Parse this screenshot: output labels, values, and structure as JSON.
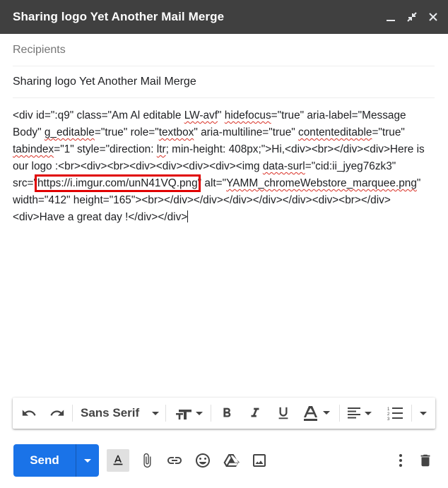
{
  "window": {
    "title": "Sharing logo Yet Another Mail Merge",
    "controls": [
      "minimize-icon",
      "exit-fullscreen-icon",
      "close-icon"
    ]
  },
  "recipients": {
    "placeholder": "Recipients"
  },
  "subject": {
    "value": "Sharing logo Yet Another Mail Merge"
  },
  "body": {
    "t1": "<div id=\":q9\" class=\"Am Al editable ",
    "s1": "LW-avf",
    "t2": "\" ",
    "s2": "hidefocus",
    "t3": "=\"true\" aria-label=\"Message Body\" ",
    "s3": "g_editable",
    "t4": "=\"true\" role=\"",
    "s4": "textbox",
    "t5": "\" aria-multiline=\"true\" ",
    "s5": "contenteditable",
    "t6": "=\"true\" ",
    "s6": "tabindex",
    "t7": "=\"1\" style=\"direction: ",
    "s7": "ltr",
    "t8": "; min-height: 408px;\">Hi,<div><br></div><div>Here is our logo :<br><div><br><div><div><div><div><img ",
    "s8": "data-surl",
    "t9": "=\"cid:ii_jyeg76zk3\" src=\"",
    "link": "https://i.imgur.com/unN41VQ.png",
    "t10": "\" alt=\"",
    "s9": "YAMM_chromeWebstore_marquee.png",
    "t11": "\" width=\"412\" height=\"165\"><br></div></div></div></div></div><div><br></div><div>Have a great day !</div></div>"
  },
  "toolbar": {
    "font_name": "Sans Serif",
    "items": [
      "undo-icon",
      "redo-icon",
      "font-dropdown",
      "text-size-icon",
      "bold-icon",
      "italic-icon",
      "underline-icon",
      "text-color-icon",
      "align-icon",
      "numbered-list-icon",
      "more-formatting-icon"
    ]
  },
  "send": {
    "label": "Send"
  },
  "bottom_icons": [
    "formatting-options-icon",
    "attach-icon",
    "link-icon",
    "emoji-icon",
    "drive-icon",
    "photo-icon",
    "more-options-icon",
    "discard-icon"
  ],
  "colors": {
    "titlebar": "#404040",
    "send": "#1a73e8",
    "highlight": "#e00000",
    "spell": "#d93025"
  }
}
